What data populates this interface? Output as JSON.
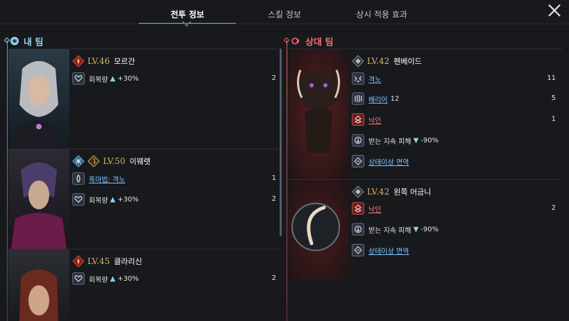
{
  "tabs": [
    {
      "label": "전투 정보"
    },
    {
      "label": "스킬 정보"
    },
    {
      "label": "상시 적용 효과"
    }
  ],
  "my_team": {
    "title": "내 팀",
    "units": [
      {
        "level": "LV.46",
        "name": "모르간",
        "stats": [
          {
            "label": "회복량",
            "value": "+30%",
            "count": "2"
          }
        ]
      },
      {
        "level": "LV.50",
        "name": "이웨렛",
        "badge": "1",
        "stats": [
          {
            "label": "흑마법: 격노",
            "count": "1"
          },
          {
            "label": "회복량",
            "value": "+30%",
            "count": "2"
          }
        ]
      },
      {
        "level": "LV.45",
        "name": "클라리신",
        "stats": [
          {
            "label": "회복량",
            "value": "+30%",
            "count": "2"
          }
        ]
      }
    ]
  },
  "enemy_team": {
    "title": "상대 팀",
    "units": [
      {
        "level": "LV.42",
        "name": "펜베이드",
        "stats": [
          {
            "label": "격노",
            "count": "11"
          },
          {
            "label": "배리어",
            "extra": "12",
            "count": "5"
          },
          {
            "label": "낙인",
            "count": "1"
          },
          {
            "label": "받는 지속 피해",
            "value": "-90%"
          },
          {
            "label": "상태이상 면역"
          }
        ]
      },
      {
        "level": "LV.42",
        "name": "왼쪽 어금니",
        "stats": [
          {
            "label": "낙인",
            "count": "2"
          },
          {
            "label": "받는 지속 피해",
            "value": "-90%"
          },
          {
            "label": "상태이상 면역"
          }
        ]
      }
    ]
  },
  "colors": {
    "my_team": "#8ed4ee",
    "enemy_team": "#ff6b67",
    "level": "#d9b36b",
    "link": "#7fc5ff"
  }
}
